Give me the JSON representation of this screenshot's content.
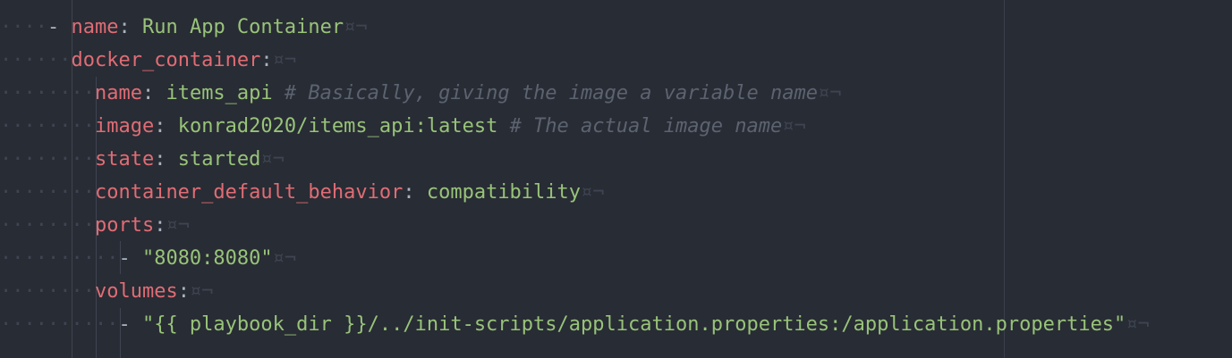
{
  "colors": {
    "background": "#282c34",
    "key": "#e06c75",
    "string": "#98c379",
    "comment": "#5c6370",
    "punctuation": "#abb2bf",
    "invisibles": "#3e4451"
  },
  "eol_marker": "¤¬",
  "lines": [
    {
      "ws": "····",
      "dash": "- ",
      "key": "name",
      "sep": ": ",
      "value": "Run App Container",
      "comment": ""
    },
    {
      "ws": "······",
      "dash": "",
      "key": "docker_container",
      "sep": ":",
      "value": "",
      "comment": ""
    },
    {
      "ws": "········",
      "dash": "",
      "key": "name",
      "sep": ": ",
      "value": "items_api",
      "comment": " # Basically, giving the image a variable name"
    },
    {
      "ws": "········",
      "dash": "",
      "key": "image",
      "sep": ": ",
      "value": "konrad2020/items_api:latest",
      "comment": " # The actual image name"
    },
    {
      "ws": "········",
      "dash": "",
      "key": "state",
      "sep": ": ",
      "value": "started",
      "comment": ""
    },
    {
      "ws": "········",
      "dash": "",
      "key": "container_default_behavior",
      "sep": ": ",
      "value": "compatibility",
      "comment": ""
    },
    {
      "ws": "········",
      "dash": "",
      "key": "ports",
      "sep": ":",
      "value": "",
      "comment": ""
    },
    {
      "ws": "··········",
      "dash": "- ",
      "key": "",
      "sep": "",
      "value": "\"8080:8080\"",
      "comment": ""
    },
    {
      "ws": "········",
      "dash": "",
      "key": "volumes",
      "sep": ":",
      "value": "",
      "comment": ""
    },
    {
      "ws": "··········",
      "dash": "- ",
      "key": "",
      "sep": "",
      "value": "\"{{ playbook_dir }}/../init-scripts/application.properties:/application.properties\"",
      "comment": ""
    }
  ]
}
